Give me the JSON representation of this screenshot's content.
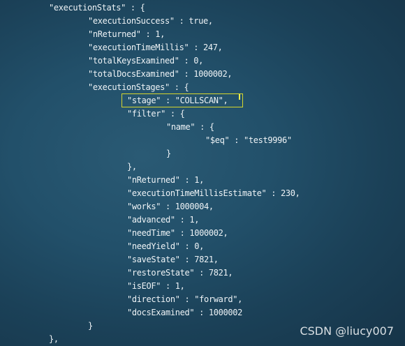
{
  "terminal": {
    "lines": [
      "\"executionStats\" : {",
      "\"executionSuccess\" : true,",
      "\"nReturned\" : 1,",
      "\"executionTimeMillis\" : 247,",
      "\"totalKeysExamined\" : 0,",
      "\"totalDocsExamined\" : 1000002,",
      "\"executionStages\" : {",
      "\"stage\" : \"COLLSCAN\",",
      "\"filter\" : {",
      "\"name\" : {",
      "\"$eq\" : \"test9996\"",
      "}",
      "},",
      "\"nReturned\" : 1,",
      "\"executionTimeMillisEstimate\" : 230,",
      "\"works\" : 1000004,",
      "\"advanced\" : 1,",
      "\"needTime\" : 1000002,",
      "\"needYield\" : 0,",
      "\"saveState\" : 7821,",
      "\"restoreState\" : 7821,",
      "\"isEOF\" : 1,",
      "\"direction\" : \"forward\",",
      "\"docsExamined\" : 1000002",
      "}",
      "},"
    ]
  },
  "watermark": {
    "text": "CSDN @liucy007"
  },
  "colors": {
    "highlight_border": "#d6d62e",
    "text": "#eef3f6"
  }
}
